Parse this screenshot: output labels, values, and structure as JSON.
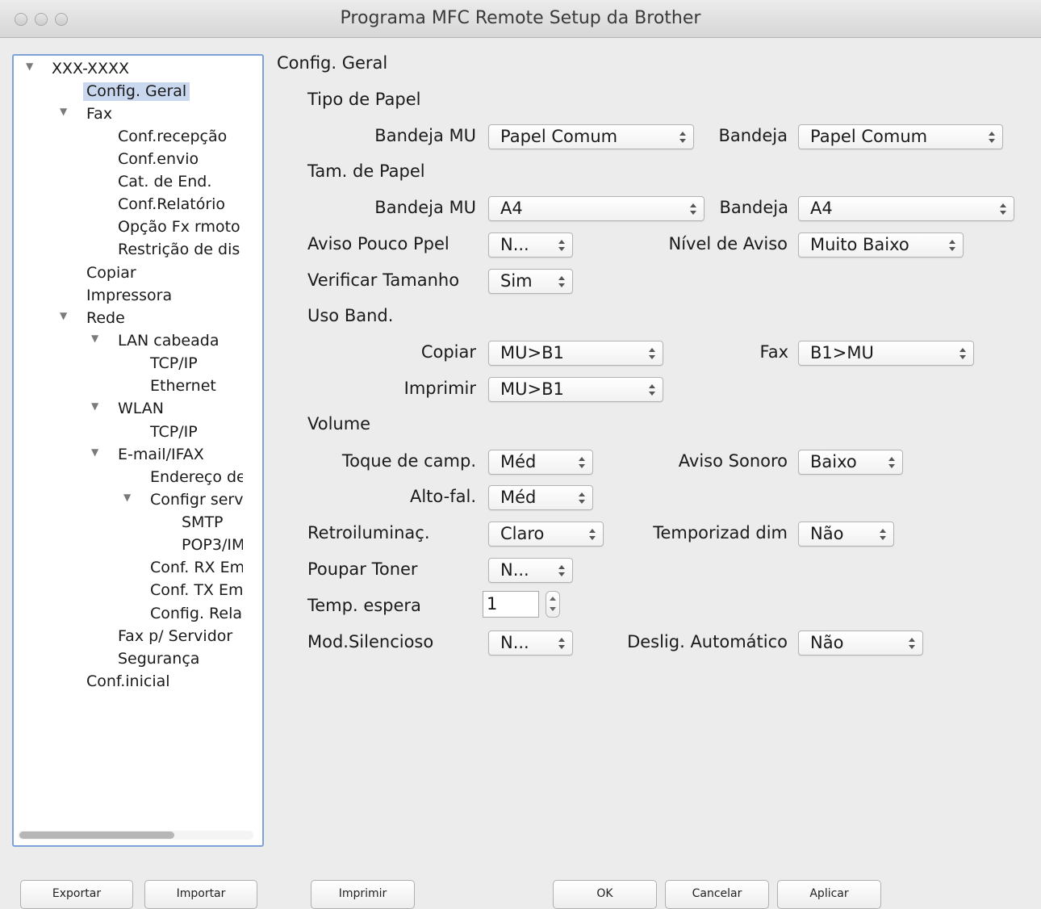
{
  "window": {
    "title": "Programa MFC Remote Setup da Brother"
  },
  "tree": {
    "items": [
      {
        "label": "XXX-XXXX"
      },
      {
        "label": "Config. Geral"
      },
      {
        "label": "Fax"
      },
      {
        "label": "Conf.recepção"
      },
      {
        "label": "Conf.envio"
      },
      {
        "label": "Cat. de End."
      },
      {
        "label": "Conf.Relatório"
      },
      {
        "label": "Opção Fx rmoto"
      },
      {
        "label": "Restrição de dis"
      },
      {
        "label": "Copiar"
      },
      {
        "label": "Impressora"
      },
      {
        "label": "Rede"
      },
      {
        "label": "LAN cabeada"
      },
      {
        "label": "TCP/IP"
      },
      {
        "label": "Ethernet"
      },
      {
        "label": "WLAN"
      },
      {
        "label": "TCP/IP"
      },
      {
        "label": "E-mail/IFAX"
      },
      {
        "label": "Endereço de"
      },
      {
        "label": "Configr serv"
      },
      {
        "label": "SMTP"
      },
      {
        "label": "POP3/IM"
      },
      {
        "label": "Conf. RX Em"
      },
      {
        "label": "Conf. TX Em"
      },
      {
        "label": "Config. Rela"
      },
      {
        "label": "Fax p/ Servidor"
      },
      {
        "label": "Segurança"
      },
      {
        "label": "Conf.inicial"
      }
    ]
  },
  "main": {
    "section_title": "Config. Geral",
    "tipo_papel": {
      "heading": "Tipo de Papel",
      "bandeja_mu_label": "Bandeja MU",
      "bandeja_mu_value": "Papel Comum",
      "bandeja_label": "Bandeja",
      "bandeja_value": "Papel Comum"
    },
    "tam_papel": {
      "heading": "Tam. de Papel",
      "bandeja_mu_label": "Bandeja MU",
      "bandeja_mu_value": "A4",
      "bandeja_label": "Bandeja",
      "bandeja_value": "A4"
    },
    "aviso_pouco_papel": {
      "label": "Aviso Pouco Ppel",
      "value": "N..."
    },
    "nivel_aviso": {
      "label": "Nível de Aviso",
      "value": "Muito Baixo"
    },
    "verificar_tamanho": {
      "label": "Verificar Tamanho",
      "value": "Sim"
    },
    "uso_band": {
      "heading": "Uso Band.",
      "copiar_label": "Copiar",
      "copiar_value": "MU>B1",
      "fax_label": "Fax",
      "fax_value": "B1>MU",
      "imprimir_label": "Imprimir",
      "imprimir_value": "MU>B1"
    },
    "volume": {
      "heading": "Volume",
      "toque_label": "Toque de camp.",
      "toque_value": "Méd",
      "aviso_sonoro_label": "Aviso Sonoro",
      "aviso_sonoro_value": "Baixo",
      "alto_fal_label": "Alto-fal.",
      "alto_fal_value": "Méd"
    },
    "retroiluminac": {
      "label": "Retroiluminaç.",
      "value": "Claro"
    },
    "temporizad_dim": {
      "label": "Temporizad dim",
      "value": "Não"
    },
    "poupar_toner": {
      "label": "Poupar Toner",
      "value": "N..."
    },
    "temp_espera": {
      "label": "Temp. espera",
      "value": "1"
    },
    "mod_silencioso": {
      "label": "Mod.Silencioso",
      "value": "N..."
    },
    "deslig_automatico": {
      "label": "Deslig. Automático",
      "value": "Não"
    }
  },
  "buttons": {
    "exportar": "Exportar",
    "importar": "Importar",
    "imprimir": "Imprimir",
    "ok": "OK",
    "cancelar": "Cancelar",
    "aplicar": "Aplicar"
  }
}
